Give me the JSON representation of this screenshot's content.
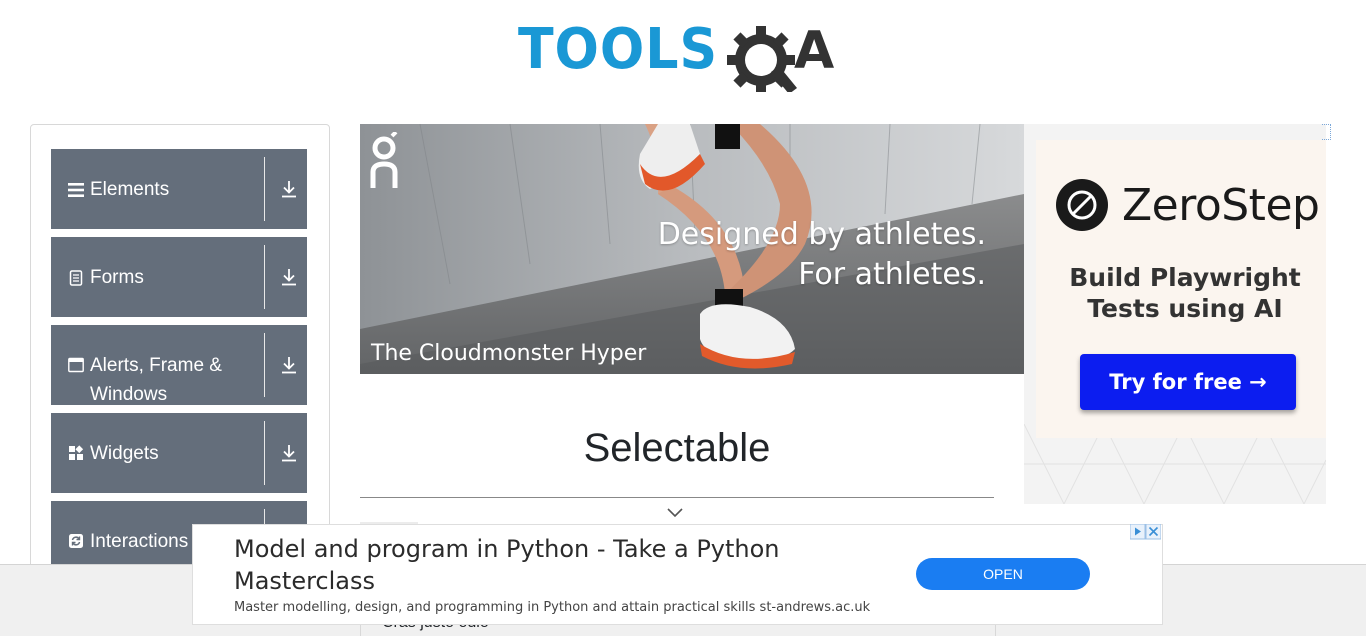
{
  "logo": {
    "text": "TOOLSQA",
    "colors": {
      "tools": "#1a98d5",
      "qa": "#333333"
    }
  },
  "sidebar": {
    "groups": [
      {
        "label": "Elements",
        "icon": "menu-icon"
      },
      {
        "label": "Forms",
        "icon": "document-icon"
      },
      {
        "label": "Alerts, Frame & Windows",
        "icon": "window-icon"
      },
      {
        "label": "Widgets",
        "icon": "widgets-icon"
      },
      {
        "label": "Interactions",
        "icon": "refresh-icon"
      }
    ],
    "group_color": "#646e7b",
    "download_icon": "download-icon"
  },
  "banner": {
    "brand_icon": "on-logo-icon",
    "headline_line1": "Designed by athletes.",
    "headline_line2": "For athletes.",
    "product": "The Cloudmonster Hyper"
  },
  "main": {
    "title": "Selectable",
    "expand_icon": "chevron-down-icon",
    "first_item_text": "Cras justo odio"
  },
  "right_ad": {
    "brand": "ZeroStep",
    "tagline": "Build Playwright Tests using AI",
    "cta": "Try for free →",
    "cta_color": "#0c1df0"
  },
  "bottom_ad": {
    "title": "Model and program in Python - Take a Python Masterclass",
    "description": "Master modelling, design, and programming in Python and attain practical skills st-andrews.ac.uk",
    "button": "OPEN",
    "button_color": "#1a7df2"
  }
}
